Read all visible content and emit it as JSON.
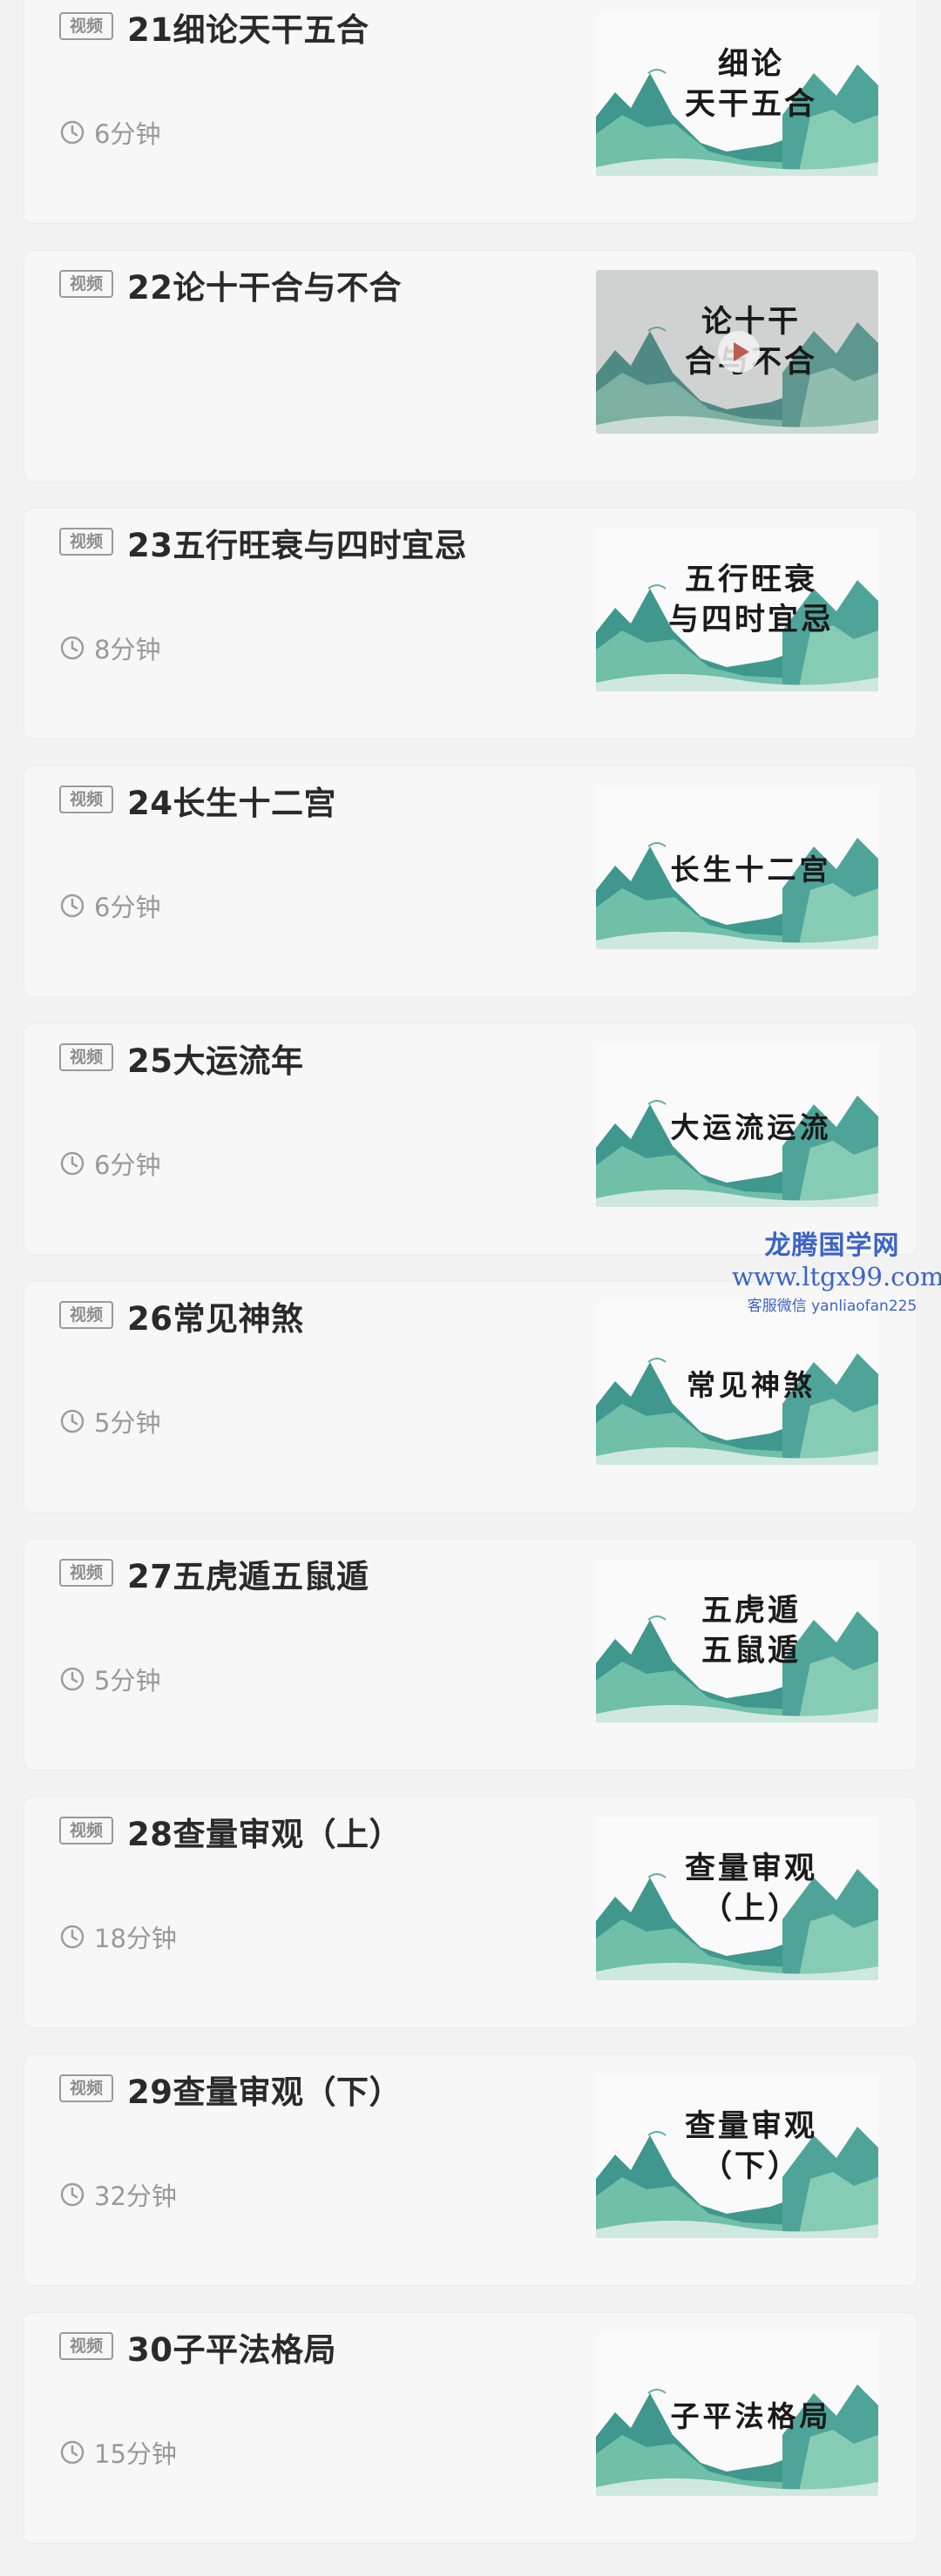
{
  "lessons": [
    {
      "tag": "视频",
      "title": "21细论天干五合",
      "duration": "6分钟",
      "thumb_text": "细论\n天干五合",
      "playing": false
    },
    {
      "tag": "视频",
      "title": "22论十干合与不合",
      "duration": "",
      "thumb_text": "论十干\n合与不合",
      "playing": true
    },
    {
      "tag": "视频",
      "title": "23五行旺衰与四时宜忌",
      "duration": "8分钟",
      "thumb_text": "五行旺衰\n与四时宜忌",
      "playing": false
    },
    {
      "tag": "视频",
      "title": "24长生十二宫",
      "duration": "6分钟",
      "thumb_text": "长生十二宫",
      "playing": false
    },
    {
      "tag": "视频",
      "title": "25大运流年",
      "duration": "6分钟",
      "thumb_text": "大运流运流",
      "playing": false
    },
    {
      "tag": "视频",
      "title": "26常见神煞",
      "duration": "5分钟",
      "thumb_text": "常见神煞",
      "playing": false
    },
    {
      "tag": "视频",
      "title": "27五虎遁五鼠遁",
      "duration": "5分钟",
      "thumb_text": "五虎遁\n五鼠遁",
      "playing": false
    },
    {
      "tag": "视频",
      "title": "28查量审观（上）",
      "duration": "18分钟",
      "thumb_text": "查量审观\n（上）",
      "playing": false
    },
    {
      "tag": "视频",
      "title": "29查量审观（下）",
      "duration": "32分钟",
      "thumb_text": "查量审观\n（下）",
      "playing": false
    },
    {
      "tag": "视频",
      "title": "30子平法格局",
      "duration": "15分钟",
      "thumb_text": "子平法格局",
      "playing": false
    }
  ],
  "watermark": {
    "name": "龙腾国学网",
    "url": "www.ltgx99.com",
    "service": "客服微信 yanliaofan225"
  },
  "colors": {
    "card_bg": "#f7f7f7",
    "page_bg": "#f2f2f2",
    "mountain_teal": "#4fa49a",
    "play_red": "#e8574a"
  },
  "icons": {
    "duration": "clock-icon",
    "play": "play-icon"
  }
}
